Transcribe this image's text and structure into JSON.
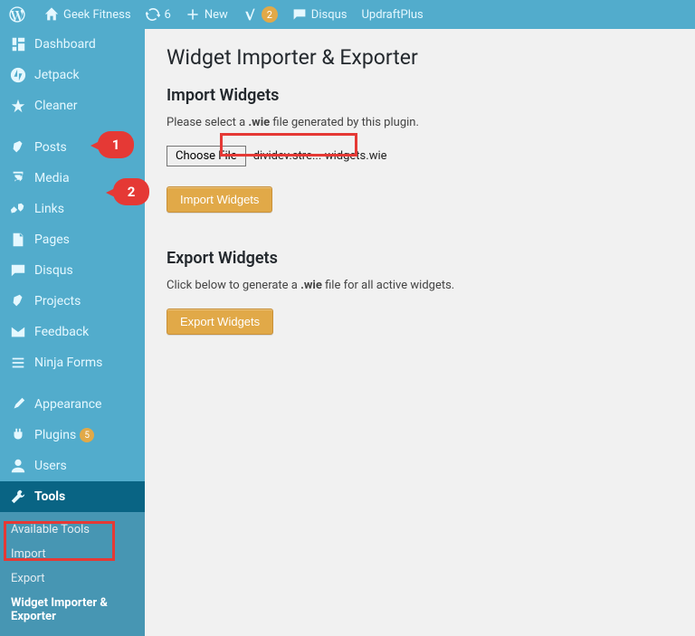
{
  "adminbar": {
    "site_title": "Geek Fitness",
    "updates_count": "6",
    "new_label": "New",
    "yoast_count": "2",
    "disqus_label": "Disqus",
    "updraft_label": "UpdraftPlus"
  },
  "sidebar": {
    "items": [
      {
        "label": "Dashboard"
      },
      {
        "label": "Jetpack"
      },
      {
        "label": "Cleaner"
      },
      {
        "label": "Posts"
      },
      {
        "label": "Media"
      },
      {
        "label": "Links"
      },
      {
        "label": "Pages"
      },
      {
        "label": "Disqus"
      },
      {
        "label": "Projects"
      },
      {
        "label": "Feedback"
      },
      {
        "label": "Ninja Forms"
      },
      {
        "label": "Appearance"
      },
      {
        "label": "Plugins",
        "count": "5"
      },
      {
        "label": "Users"
      },
      {
        "label": "Tools"
      }
    ],
    "submenu": [
      {
        "label": "Available Tools"
      },
      {
        "label": "Import"
      },
      {
        "label": "Export"
      },
      {
        "label": "Widget Importer & Exporter"
      }
    ]
  },
  "page": {
    "title": "Widget Importer & Exporter",
    "import_heading": "Import Widgets",
    "import_instruction_pre": "Please select a ",
    "import_instruction_ext": ".wie",
    "import_instruction_post": " file generated by this plugin.",
    "choose_file_label": "Choose File",
    "selected_file": "dividev.stre...-widgets.wie",
    "import_button": "Import Widgets",
    "export_heading": "Export Widgets",
    "export_instruction_pre": "Click below to generate a ",
    "export_instruction_ext": ".wie",
    "export_instruction_post": " file for all active widgets.",
    "export_button": "Export Widgets"
  },
  "annotations": {
    "num1": "1",
    "num2": "2"
  }
}
